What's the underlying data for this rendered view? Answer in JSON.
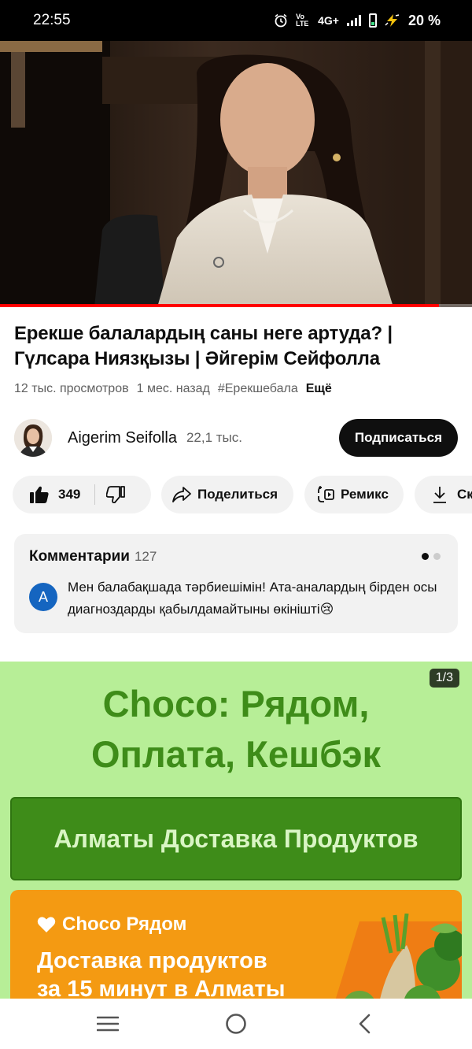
{
  "status_bar": {
    "time": "22:55",
    "network_label": "4G+",
    "volte_label": "Vo LTE",
    "battery_percent": "20 %",
    "battery_level": 0.2
  },
  "video": {
    "progress": 0.93,
    "accent_color": "#ff0000"
  },
  "video_info": {
    "title": "Ерекше балалардың саны неге артуда? | Гүлсара Ниязқызы | Әйгерім Сейфолла",
    "views": "12 тыс. просмотров",
    "age": "1 мес. назад",
    "hashtag": "#Ерекшебала",
    "more_label": "Ещё"
  },
  "channel": {
    "name": "Aigerim Seifolla",
    "subscribers": "22,1 тыс.",
    "subscribe_label": "Подписаться"
  },
  "actions": {
    "like_count": "349",
    "share_label": "Поделиться",
    "remix_label": "Ремикс",
    "download_label": "Ск"
  },
  "comments": {
    "heading": "Комментарии",
    "count": "127",
    "author_initial": "A",
    "author_color": "#1565c0",
    "top_comment": "Мен балабақшада тәрбиешімін! Ата-аналардың бірден осы диагноздарды қабылдамайтыны өкінішті😢"
  },
  "ad": {
    "counter": "1/3",
    "headline_line1": "Choco: Рядом,",
    "headline_line2": "Оплата, Кешбэк",
    "banner_text": "Алматы Доставка Продуктов",
    "brand": "Choco Рядом",
    "subline1": "Доставка продуктов",
    "subline2": "за 15 минут в Алматы",
    "bg_color": "#b7ee97",
    "green_color": "#3e8c19",
    "orange_color": "#f49a12"
  },
  "nav_bar": {
    "icons": [
      "recent-apps-icon",
      "home-icon",
      "back-icon"
    ]
  }
}
